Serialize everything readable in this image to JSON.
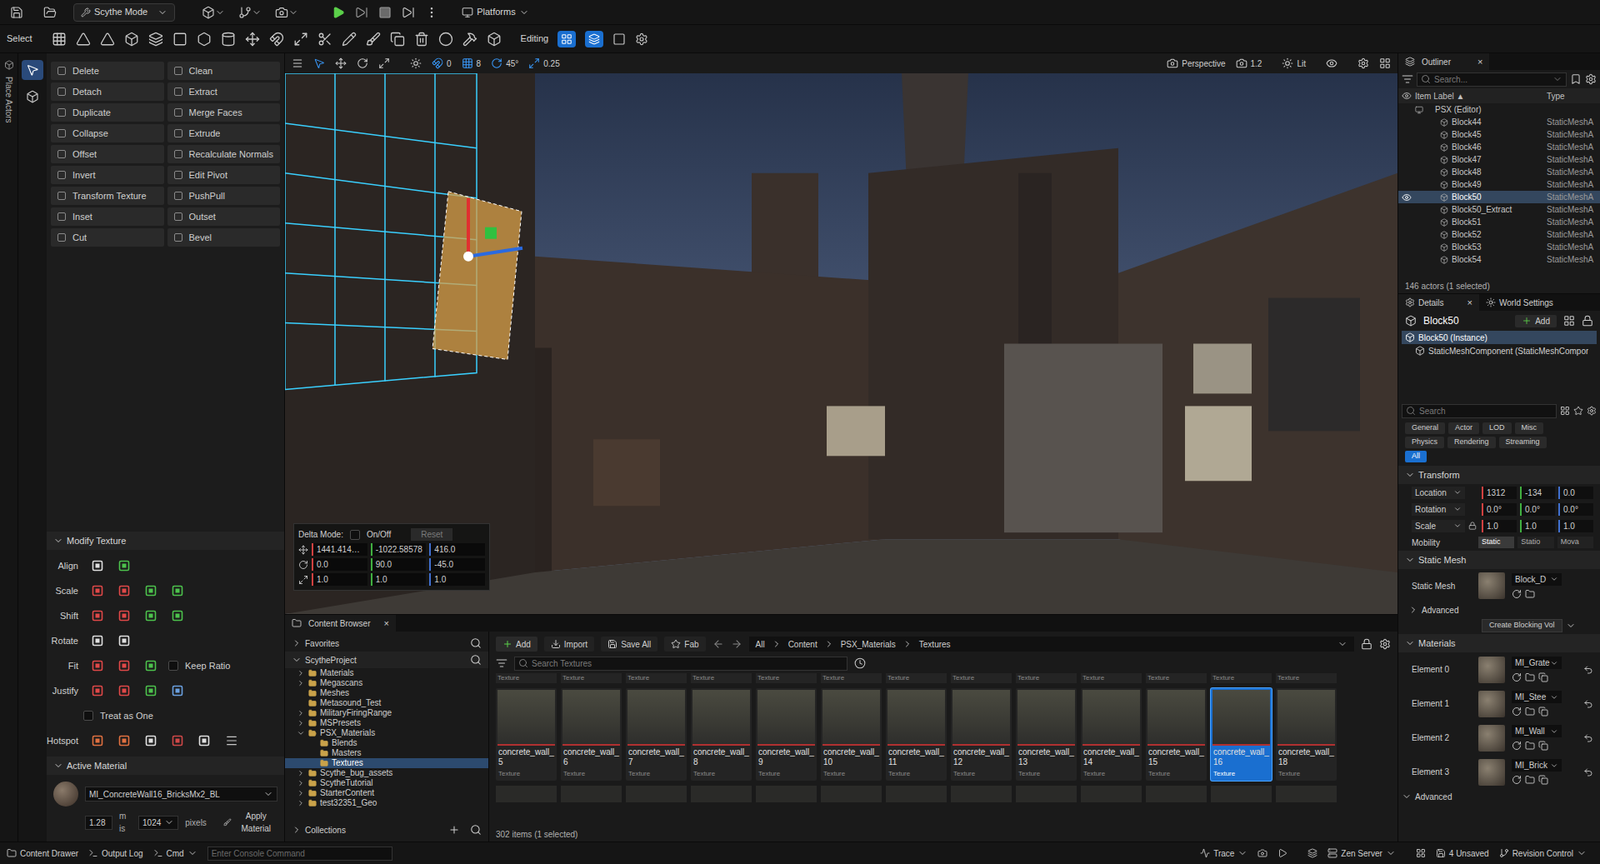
{
  "toolbar": {
    "mode": "Scythe Mode",
    "platforms": "Platforms",
    "select_label": "Select",
    "editing_label": "Editing"
  },
  "left_strip": {
    "label": "Place Actors"
  },
  "tool_buttons": [
    {
      "label": "Delete"
    },
    {
      "label": "Clean"
    },
    {
      "label": "Detach"
    },
    {
      "label": "Extract"
    },
    {
      "label": "Duplicate"
    },
    {
      "label": "Merge Faces"
    },
    {
      "label": "Collapse"
    },
    {
      "label": "Extrude"
    },
    {
      "label": "Offset"
    },
    {
      "label": "Recalculate Normals"
    },
    {
      "label": "Invert"
    },
    {
      "label": "Edit Pivot"
    },
    {
      "label": "Transform Texture"
    },
    {
      "label": "PushPull"
    },
    {
      "label": "Inset"
    },
    {
      "label": "Outset"
    },
    {
      "label": "Cut"
    },
    {
      "label": "Bevel"
    }
  ],
  "modify_texture": {
    "title": "Modify Texture",
    "expanded": true,
    "rows": [
      {
        "kind": "icons",
        "label": "Align"
      },
      {
        "kind": "icons",
        "label": "Scale"
      },
      {
        "kind": "icons",
        "label": "Shift"
      },
      {
        "kind": "icons",
        "label": "Rotate"
      },
      {
        "kind": "icons",
        "label": "Fit",
        "option": {
          "label": "Keep Ratio",
          "checked": false
        }
      },
      {
        "kind": "icons",
        "label": "Justify"
      },
      {
        "kind": "checkbox",
        "label": "Treat as One",
        "checked": false
      },
      {
        "kind": "icons",
        "label": "Hotspot"
      }
    ]
  },
  "active_material": {
    "title": "Active Material",
    "expanded": true,
    "name": "MI_ConcreteWall16_BricksMx2_BL",
    "scale": "1.28",
    "unit": "m is",
    "pixels": "1024",
    "pixels_label": "pixels",
    "apply": "Apply Material"
  },
  "viewport": {
    "snaps": [
      "0",
      "8",
      "45°",
      "0.25"
    ],
    "view_mode": "Perspective",
    "camera_speed": "1.2",
    "lighting": "Lit",
    "delta": {
      "label": "Delta Mode:",
      "toggle": "On/Off",
      "on": false,
      "reset": "Reset",
      "rows": [
        [
          "1441.414215",
          "-1022.58578",
          "416.0"
        ],
        [
          "0.0",
          "90.0",
          "-45.0"
        ],
        [
          "1.0",
          "1.0",
          "1.0"
        ]
      ]
    }
  },
  "content_browser": {
    "tab": "Content Browser",
    "close": "×",
    "favorites": "Favorites",
    "project": "ScytheProject",
    "collections": "Collections",
    "tree": [
      {
        "label": "Materials",
        "expandable": true,
        "expanded": false,
        "selected": false
      },
      {
        "label": "Megascans",
        "expandable": true,
        "expanded": false,
        "selected": false
      },
      {
        "label": "Meshes",
        "expandable": false,
        "expanded": false,
        "selected": false
      },
      {
        "label": "Metasound_Test",
        "expandable": false,
        "expanded": false,
        "selected": false
      },
      {
        "label": "MilitaryFiringRange",
        "expandable": true,
        "expanded": false,
        "selected": false
      },
      {
        "label": "MSPresets",
        "expandable": true,
        "expanded": false,
        "selected": false
      },
      {
        "label": "PSX_Materials",
        "expandable": true,
        "expanded": true,
        "selected": false,
        "children": [
          {
            "label": "Blends",
            "expandable": false,
            "expanded": false,
            "selected": false
          },
          {
            "label": "Masters",
            "expandable": false,
            "expanded": false,
            "selected": false
          },
          {
            "label": "Textures",
            "expandable": false,
            "expanded": false,
            "selected": true
          }
        ]
      },
      {
        "label": "Scythe_bug_assets",
        "expandable": true,
        "expanded": false,
        "selected": false
      },
      {
        "label": "ScytheTutorial",
        "expandable": true,
        "expanded": false,
        "selected": false
      },
      {
        "label": "StarterContent",
        "expandable": true,
        "expanded": false,
        "selected": false
      },
      {
        "label": "test32351_Geo",
        "expandable": true,
        "expanded": false,
        "selected": false
      }
    ],
    "buttons": [
      {
        "label": "Add"
      },
      {
        "label": "Import"
      },
      {
        "label": "Save All"
      },
      {
        "label": "Fab"
      }
    ],
    "breadcrumb": [
      "All",
      "Content",
      "PSX_Materials",
      "Textures"
    ],
    "search_placeholder": "Search Textures",
    "assets": [
      {
        "name": "concrete_wall_5",
        "type": "Texture",
        "selected": false
      },
      {
        "name": "concrete_wall_6",
        "type": "Texture",
        "selected": false
      },
      {
        "name": "concrete_wall_7",
        "type": "Texture",
        "selected": false
      },
      {
        "name": "concrete_wall_8",
        "type": "Texture",
        "selected": false
      },
      {
        "name": "concrete_wall_9",
        "type": "Texture",
        "selected": false
      },
      {
        "name": "concrete_wall_10",
        "type": "Texture",
        "selected": false
      },
      {
        "name": "concrete_wall_11",
        "type": "Texture",
        "selected": false
      },
      {
        "name": "concrete_wall_12",
        "type": "Texture",
        "selected": false
      },
      {
        "name": "concrete_wall_13",
        "type": "Texture",
        "selected": false
      },
      {
        "name": "concrete_wall_14",
        "type": "Texture",
        "selected": false
      },
      {
        "name": "concrete_wall_15",
        "type": "Texture",
        "selected": false
      },
      {
        "name": "concrete_wall_16",
        "type": "Texture",
        "selected": true
      },
      {
        "name": "concrete_wall_18",
        "type": "Texture",
        "selected": false
      }
    ],
    "count": "302 items (1 selected)"
  },
  "outliner": {
    "title": "Outliner",
    "close": "×",
    "search_placeholder": "Search...",
    "columns": [
      "Item Label ▲",
      "Type"
    ],
    "rows": [
      {
        "label": "PSX (Editor)",
        "type": "",
        "selected": false,
        "visible": false
      },
      {
        "label": "Block44",
        "type": "StaticMeshA",
        "selected": false,
        "visible": false
      },
      {
        "label": "Block45",
        "type": "StaticMeshA",
        "selected": false,
        "visible": false
      },
      {
        "label": "Block46",
        "type": "StaticMeshA",
        "selected": false,
        "visible": false
      },
      {
        "label": "Block47",
        "type": "StaticMeshA",
        "selected": false,
        "visible": false
      },
      {
        "label": "Block48",
        "type": "StaticMeshA",
        "selected": false,
        "visible": false
      },
      {
        "label": "Block49",
        "type": "StaticMeshA",
        "selected": false,
        "visible": false
      },
      {
        "label": "Block50",
        "type": "StaticMeshA",
        "selected": true,
        "visible": true
      },
      {
        "label": "Block50_Extract",
        "type": "StaticMeshA",
        "selected": false,
        "visible": false
      },
      {
        "label": "Block51",
        "type": "StaticMeshA",
        "selected": false,
        "visible": false
      },
      {
        "label": "Block52",
        "type": "StaticMeshA",
        "selected": false,
        "visible": false
      },
      {
        "label": "Block53",
        "type": "StaticMeshA",
        "selected": false,
        "visible": false
      },
      {
        "label": "Block54",
        "type": "StaticMeshA",
        "selected": false,
        "visible": false
      }
    ],
    "count": "146 actors (1 selected)"
  },
  "details": {
    "tabs": [
      {
        "label": "Details",
        "selected": true
      },
      {
        "label": "World Settings",
        "selected": false
      }
    ],
    "close": "×",
    "actor": "Block50",
    "add": "Add",
    "components": [
      {
        "label": "Block50 (Instance)",
        "selected": true
      },
      {
        "label": "StaticMeshComponent (StaticMeshCompor",
        "selected": false
      }
    ],
    "search_placeholder": "Search",
    "filters": [
      {
        "label": "General",
        "selected": false
      },
      {
        "label": "Actor",
        "selected": false
      },
      {
        "label": "LOD",
        "selected": false
      },
      {
        "label": "Misc",
        "selected": false
      },
      {
        "label": "Physics",
        "selected": false
      },
      {
        "label": "Rendering",
        "selected": false
      },
      {
        "label": "Streaming",
        "selected": false
      },
      {
        "label": "All",
        "selected": true
      }
    ],
    "transform": {
      "title": "Transform",
      "rows": [
        {
          "label": "Location",
          "values": [
            "1312",
            "-134",
            "0.0"
          ]
        },
        {
          "label": "Rotation",
          "values": [
            "0.0°",
            "0.0°",
            "0.0°"
          ]
        },
        {
          "label": "Scale",
          "values": [
            "1.0",
            "1.0",
            "1.0"
          ]
        }
      ],
      "mobility": {
        "label": "Mobility",
        "options": [
          {
            "label": "Static",
            "selected": true
          },
          {
            "label": "Statio",
            "selected": false
          },
          {
            "label": "Mova",
            "selected": false
          }
        ]
      }
    },
    "static_mesh": {
      "title": "Static Mesh",
      "label": "Static Mesh",
      "value": "Block_D",
      "advanced": "Advanced",
      "blocking_button": "Create Blocking Vol"
    },
    "materials": {
      "title": "Materials",
      "elements": [
        {
          "label": "Element 0",
          "value": "MI_Grate"
        },
        {
          "label": "Element 1",
          "value": "MI_Stee"
        },
        {
          "label": "Element 2",
          "value": "MI_Wall"
        },
        {
          "label": "Element 3",
          "value": "MI_Brick"
        }
      ],
      "advanced": "Advanced"
    }
  },
  "status_bar": {
    "content_drawer": "Content Drawer",
    "output_log": "Output Log",
    "cmd": "Cmd",
    "console_placeholder": "Enter Console Command",
    "trace": "Trace",
    "zen": "Zen Server",
    "unsaved": "4 Unsaved",
    "revision": "Revision Control"
  }
}
